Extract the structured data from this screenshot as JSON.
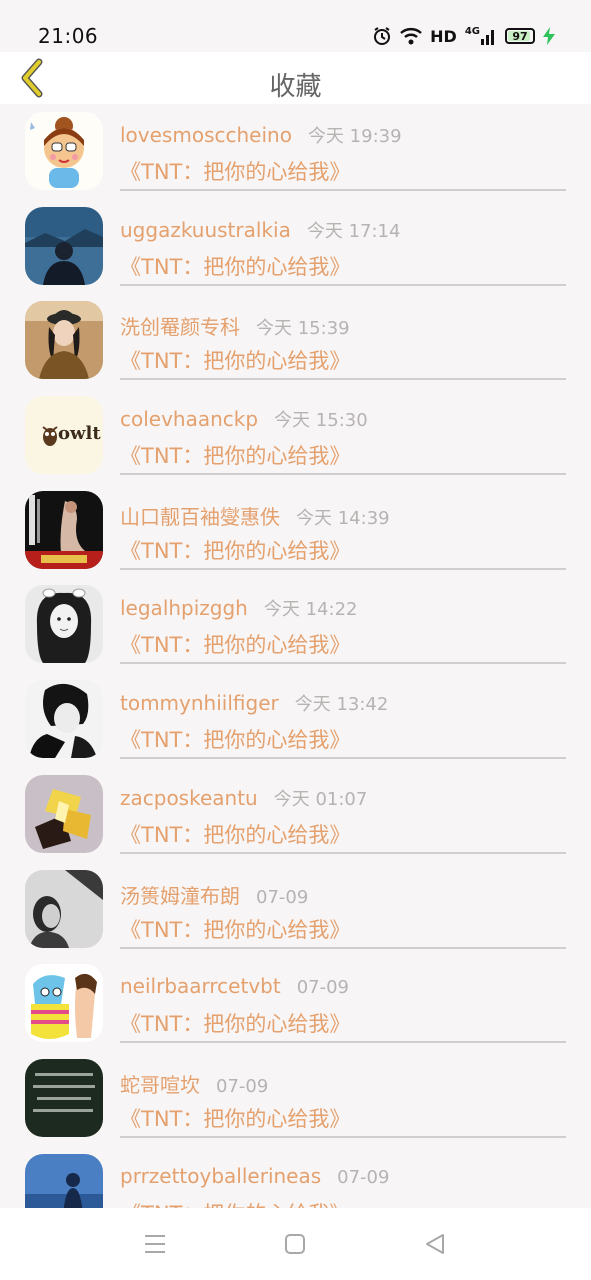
{
  "status_bar": {
    "time": "21:06",
    "network_label": "HD",
    "signal_label": "4G",
    "battery": "97",
    "icons": [
      "alarm-icon",
      "wifi-icon",
      "cellular-signal-icon",
      "battery-icon",
      "charging-bolt-icon"
    ]
  },
  "header": {
    "title": "收藏",
    "back_icon": "chevron-left-icon",
    "accent": "#e0cc2a"
  },
  "list": {
    "name_color": "#e4a16e",
    "time_color": "#b7b3b3",
    "items": [
      {
        "name": "lovesmosccheino",
        "time": "今天 19:39",
        "title": "《TNT：把你的心给我》"
      },
      {
        "name": "uggazkuustralkia",
        "time": "今天 17:14",
        "title": "《TNT：把你的心给我》"
      },
      {
        "name": "洗创罨颜专科",
        "time": "今天 15:39",
        "title": "《TNT：把你的心给我》"
      },
      {
        "name": "colevhaanckp",
        "time": "今天 15:30",
        "title": "《TNT：把你的心给我》",
        "avatar_text": "owlt"
      },
      {
        "name": "山口靓百袖燮惠佚",
        "time": "今天 14:39",
        "title": "《TNT：把你的心给我》"
      },
      {
        "name": "legalhpizggh",
        "time": "今天 14:22",
        "title": "《TNT：把你的心给我》"
      },
      {
        "name": "tommynhiilfiger",
        "time": "今天 13:42",
        "title": "《TNT：把你的心给我》"
      },
      {
        "name": "zacposkeantu",
        "time": "今天 01:07",
        "title": "《TNT：把你的心给我》"
      },
      {
        "name": "汤篑姆潼布朗",
        "time": "07-09",
        "title": "《TNT：把你的心给我》"
      },
      {
        "name": "neilrbaarrcetvbt",
        "time": "07-09",
        "title": "《TNT：把你的心给我》"
      },
      {
        "name": "蛇哥喧坎",
        "time": "07-09",
        "title": "《TNT：把你的心给我》"
      },
      {
        "name": "prrzettoyballerineas",
        "time": "07-09",
        "title": "《TNT：把你的心给我》"
      }
    ]
  },
  "nav_bar": {
    "icons": [
      "menu-icon",
      "home-square-icon",
      "back-triangle-icon"
    ]
  }
}
